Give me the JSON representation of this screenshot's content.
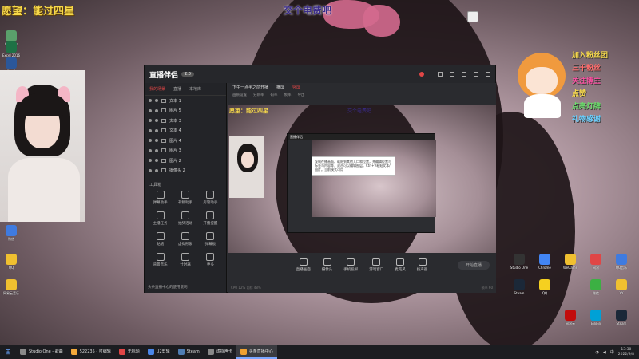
{
  "overlay": {
    "wish": "愿望：能过四星",
    "center_text": "交个电费吧",
    "labels": [
      {
        "text": "加入粉丝团",
        "color": "#f6d84a"
      },
      {
        "text": "三千粉丝",
        "color": "#ff6b6b"
      },
      {
        "text": "关注博主",
        "color": "#ff4fa3"
      },
      {
        "text": "点赞",
        "color": "#f6d84a"
      },
      {
        "text": "点亮灯牌",
        "color": "#6be06b"
      },
      {
        "text": "礼物感谢",
        "color": "#6bd0ff"
      }
    ]
  },
  "desktop_icons_left": [
    "Grabber",
    "Excel 2016",
    "Word",
    "微信",
    "QQ",
    "网易云音乐"
  ],
  "desktop_icons_right": [
    "Studio One",
    "Chrome",
    "WeGame",
    "网易",
    "QQ音乐",
    "Steam",
    "QQ",
    "微信",
    "YY",
    "网易云",
    "Bilibili",
    "Steam"
  ],
  "app": {
    "name": "直播伴侣",
    "version_badge": "2.0",
    "left_tabs": [
      "我的场景",
      "直播",
      "本地库"
    ],
    "sources": [
      {
        "name": "文本 1"
      },
      {
        "name": "图片 5"
      },
      {
        "name": "文本 3"
      },
      {
        "name": "文本 4"
      },
      {
        "name": "图片 4"
      },
      {
        "name": "图片 3"
      },
      {
        "name": "图片 2"
      },
      {
        "name": "摄像头 2"
      }
    ],
    "tools_label": "工具箱",
    "tools": [
      "弹幕助手",
      "礼物助手",
      "房管助手",
      "主播任务",
      "抽奖活动",
      "开播提醒",
      "贴纸",
      "虚拟形象",
      "弹幕板",
      "背景音乐",
      "计时器",
      "更多"
    ],
    "bottom_hint": "头条直播中心的使用说明",
    "topbar_row1": [
      "下午一点半之前开播",
      "横屏",
      "竖屏"
    ],
    "topbar_row2": [
      "画质设置",
      "分辨率",
      "码率",
      "帧率",
      "导出"
    ],
    "preview_wish": "愿望：能过四星",
    "preview_center": "交个电费吧",
    "tooltip": "复制在播画面、粘贴到其他入口和位置，并编辑位置与标签与内容等，双击可以编辑图层。Ctrl+V粘贴文本/图片。当前模式可用",
    "bottom_tools": [
      "直播画面",
      "摄像头",
      "手机投屏",
      "游戏窗口",
      "麦克风",
      "扬声器"
    ],
    "start_button": "开始直播",
    "status_left": "CPU 12%  内存 48%",
    "status_right": "帧率 60"
  },
  "taskbar": {
    "items": [
      {
        "label": "Studio One - 歌曲",
        "color": "#8a8a8a"
      },
      {
        "label": "522235 - 可编辑",
        "color": "#f4a93b"
      },
      {
        "label": "无标题",
        "color": "#e04646"
      },
      {
        "label": "U2剪辑",
        "color": "#4a86e8"
      },
      {
        "label": "Steam",
        "color": "#4f7db3"
      },
      {
        "label": "虚拟声卡",
        "color": "#888"
      },
      {
        "label": "头条直播中心",
        "color": "#f0a030"
      }
    ],
    "time": "13:30",
    "date": "2022/9/8"
  }
}
